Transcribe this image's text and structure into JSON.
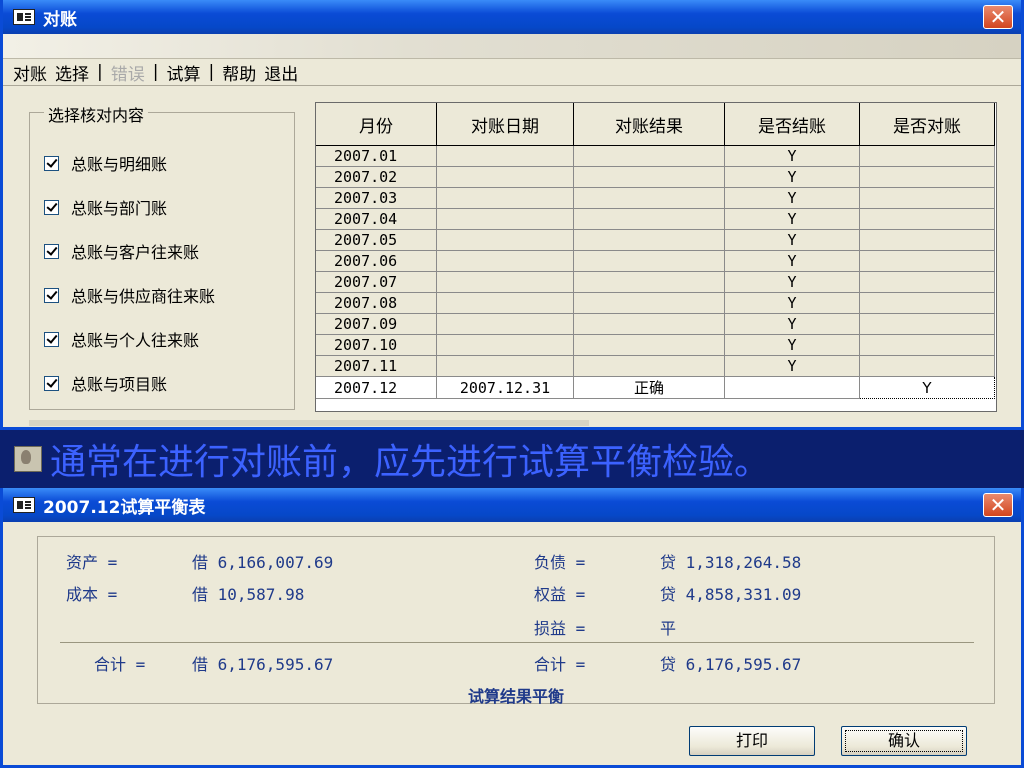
{
  "win1": {
    "title": "对账",
    "close": "✕",
    "menu": [
      {
        "label": "对账",
        "disabled": false
      },
      {
        "label": "选择",
        "disabled": false
      },
      {
        "label": "错误",
        "disabled": true
      },
      {
        "label": "试算",
        "disabled": false
      },
      {
        "label": "帮助",
        "disabled": false
      },
      {
        "label": "退出",
        "disabled": false
      }
    ],
    "group": {
      "label": "选择核对内容",
      "items": [
        {
          "label": "总账与明细账",
          "checked": true
        },
        {
          "label": "总账与部门账",
          "checked": true
        },
        {
          "label": "总账与客户往来账",
          "checked": true
        },
        {
          "label": "总账与供应商往来账",
          "checked": true
        },
        {
          "label": "总账与个人往来账",
          "checked": true
        },
        {
          "label": "总账与项目账",
          "checked": true
        }
      ]
    },
    "grid": {
      "headers": [
        "月份",
        "对账日期",
        "对账结果",
        "是否结账",
        "是否对账"
      ],
      "rows": [
        [
          "2007.01",
          "",
          "",
          "Y",
          ""
        ],
        [
          "2007.02",
          "",
          "",
          "Y",
          ""
        ],
        [
          "2007.03",
          "",
          "",
          "Y",
          ""
        ],
        [
          "2007.04",
          "",
          "",
          "Y",
          ""
        ],
        [
          "2007.05",
          "",
          "",
          "Y",
          ""
        ],
        [
          "2007.06",
          "",
          "",
          "Y",
          ""
        ],
        [
          "2007.07",
          "",
          "",
          "Y",
          ""
        ],
        [
          "2007.08",
          "",
          "",
          "Y",
          ""
        ],
        [
          "2007.09",
          "",
          "",
          "Y",
          ""
        ],
        [
          "2007.10",
          "",
          "",
          "Y",
          ""
        ],
        [
          "2007.11",
          "",
          "",
          "Y",
          ""
        ],
        [
          "2007.12",
          "2007.12.31",
          "正确",
          "",
          "Y"
        ]
      ]
    }
  },
  "banner": {
    "text": "通常在进行对账前，应先进行试算平衡检验。"
  },
  "win2": {
    "title": "2007.12试算平衡表",
    "close": "✕",
    "assets_label": "资产 =",
    "assets_value": "借 6,166,007.69",
    "cost_label": "成本 =",
    "cost_value": "借 10,587.98",
    "liab_label": "负债 =",
    "liab_value": "贷 1,318,264.58",
    "equity_label": "权益 =",
    "equity_value": "贷 4,858,331.09",
    "pl_label": "损益 =",
    "pl_value": "平",
    "total_left_label": "合计 =",
    "total_left_value": "借 6,176,595.67",
    "total_right_label": "合计 =",
    "total_right_value": "贷 6,176,595.67",
    "result": "试算结果平衡",
    "print_btn": "打印",
    "ok_btn": "确认"
  }
}
